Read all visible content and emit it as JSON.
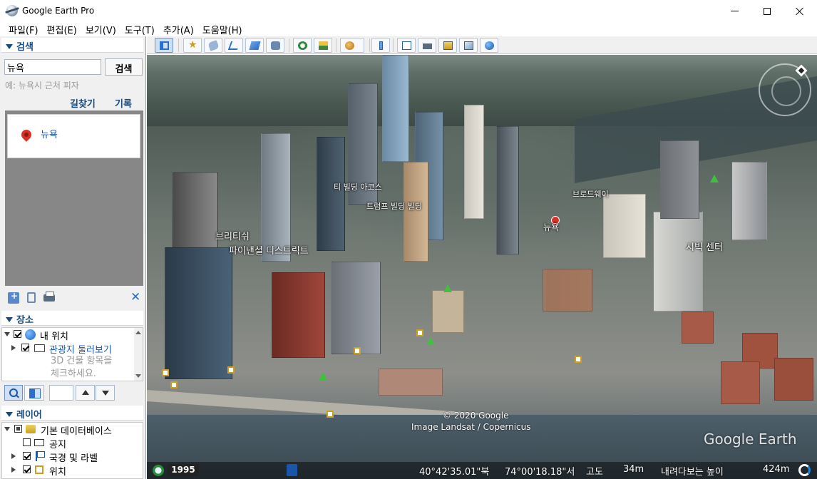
{
  "window": {
    "title": "Google Earth Pro"
  },
  "menu": [
    "파일(F)",
    "편집(E)",
    "보기(V)",
    "도구(T)",
    "추가(A)",
    "도움말(H)"
  ],
  "search": {
    "header": "검색",
    "input_value": "뉴욕",
    "button_label": "검색",
    "hint": "예: 뉴욕시 근처 피자",
    "directions_link": "길찾기",
    "history_link": "기록",
    "result_label": "뉴욕"
  },
  "places": {
    "header": "장소",
    "items": [
      {
        "label": "내 위치",
        "checked": true
      },
      {
        "label": "관광지 둘러보기",
        "checked": true,
        "note_line1": "3D 건물 항목을",
        "note_line2": "체크하세요."
      }
    ]
  },
  "layers": {
    "header": "레이어",
    "items": [
      {
        "label": "기본 데이터베이스",
        "state": "partial"
      },
      {
        "label": "공지",
        "state": "unchecked"
      },
      {
        "label": "국경 및 라벨",
        "state": "checked"
      },
      {
        "label": "위치",
        "state": "checked"
      }
    ]
  },
  "toolbar": {
    "icons": [
      "sidebar-toggle-icon",
      "placemark-icon",
      "polygon-icon",
      "path-icon",
      "image-overlay-icon",
      "record-tour-icon",
      "historical-imagery-icon",
      "sunlight-icon",
      "planets-icon",
      "ruler-icon",
      "email-icon",
      "print-icon",
      "save-image-icon",
      "google-maps-icon",
      "earth-icon"
    ]
  },
  "map": {
    "labels": {
      "building_a": "티 빌딩 아코스",
      "building_b": "트럼프 빌딩 빌딩",
      "district_label_1": "브리티쉬",
      "district_label_2": "파이낸셜 디스트릭트",
      "civic_center": "시빅 센터",
      "street_label": "브로드웨이",
      "placemark": "뉴욕"
    },
    "copyright": "© 2020 Google",
    "imagery_credit": "Image Landsat / Copernicus",
    "watermark": "Google Earth"
  },
  "status": {
    "year": "1995",
    "latitude": "40°42'35.01\"북",
    "longitude": "74°00'18.18\"서",
    "elevation_label": "고도",
    "elevation_value": "34m",
    "eye_alt_label": "내려다보는 높이",
    "eye_alt_value": "424m"
  },
  "colors": {
    "accent": "#1a4a7a",
    "link": "#1a55a8",
    "pin": "#d93025"
  }
}
